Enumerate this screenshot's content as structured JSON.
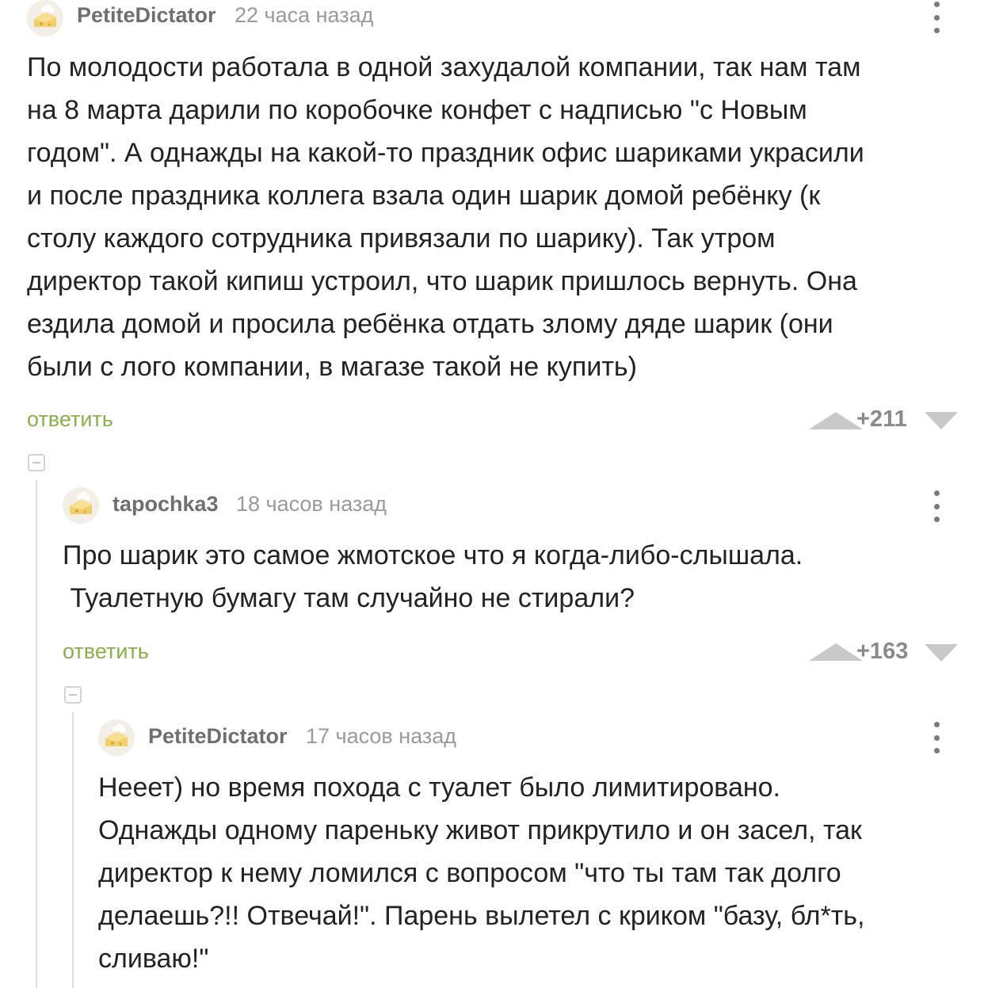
{
  "comments": [
    {
      "author": "PetiteDictator",
      "time": "22 часа назад",
      "lines": [
        "По молодости работала в одной захудалой компании, так нам там",
        "на 8 марта дарили по коробочке конфет с надписью \"с Новым",
        "годом\". А однажды на какой-то праздник офис шариками украсили",
        "и после праздника коллега взала один шарик домой ребёнку (к",
        "столу каждого сотрудника привязали по шарику). Так утром",
        "директор такой кипиш устроил, что шарик пришлось вернуть. Она",
        "ездила домой и просила ребёнка отдать злому дяде шарик (они",
        "были с лого компании, в магазе такой не купить)"
      ],
      "reply_label": "ответить",
      "rating": "+211"
    },
    {
      "author": "tapochka3",
      "time": "18 часов назад",
      "lines": [
        "Про шарик это самое жмотское что я когда-либо-слышала.",
        " Туалетную бумагу там случайно не стирали?"
      ],
      "reply_label": "ответить",
      "rating": "+163"
    },
    {
      "author": "PetiteDictator",
      "time": "17 часов назад",
      "lines": [
        "Нееет) но время похода с туалет было лимитировано.",
        "Однажды одному пареньку живот прикрутило и он засел, так",
        "директор к нему ломился с вопросом \"что ты там так долго",
        "делаешь?!! Отвечай!\". Парень вылетел с криком \"базу, бл*ть,",
        "сливаю!\""
      ]
    }
  ],
  "colors": {
    "reply": "#8ab04a",
    "meta": "#9a9a9a",
    "vote_arrow": "#c9c9c9"
  }
}
